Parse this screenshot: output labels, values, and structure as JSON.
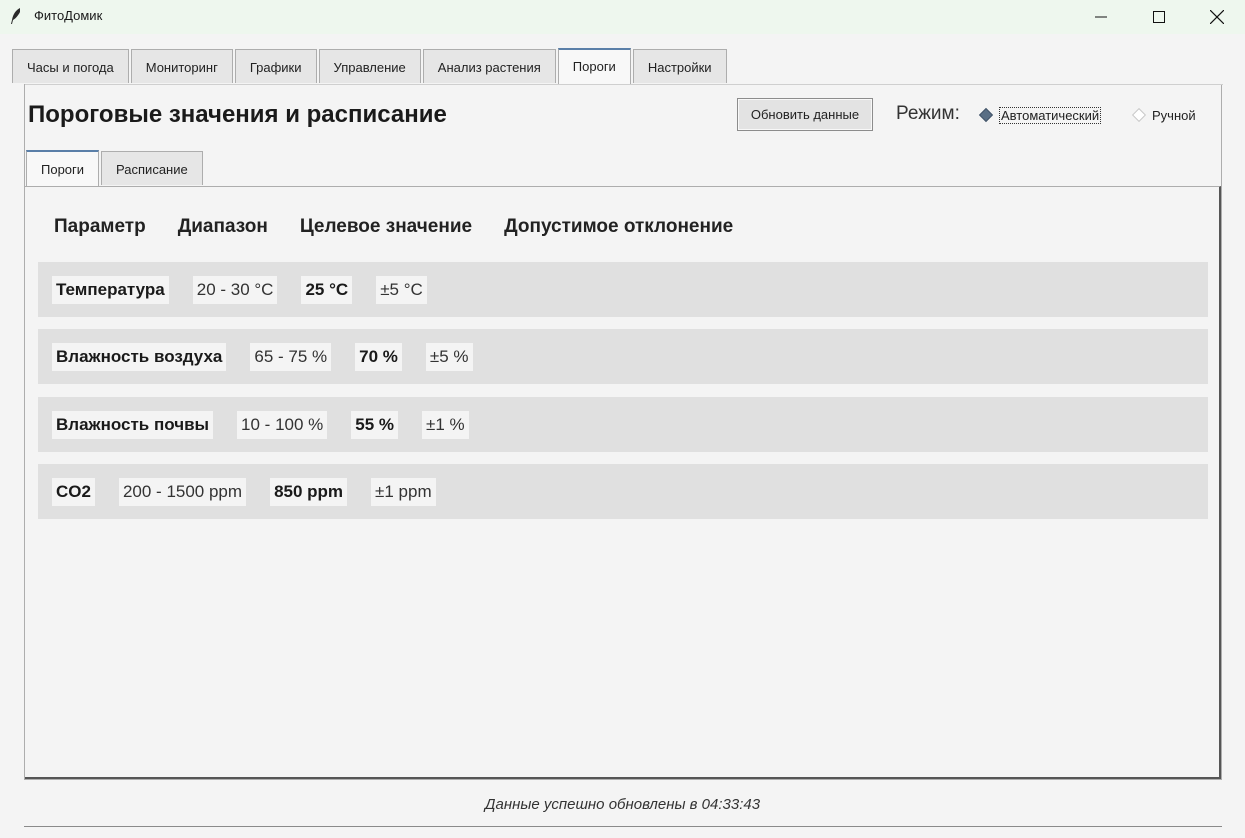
{
  "window": {
    "title": "ФитоДомик",
    "controls": {
      "minimize": "minimize-icon",
      "maximize": "maximize-icon",
      "close": "close-icon"
    },
    "icon": "feather-icon"
  },
  "main_tabs": [
    {
      "label": "Часы и погода",
      "active": false
    },
    {
      "label": "Мониторинг",
      "active": false
    },
    {
      "label": "Графики",
      "active": false
    },
    {
      "label": "Управление",
      "active": false
    },
    {
      "label": "Анализ растения",
      "active": false
    },
    {
      "label": "Пороги",
      "active": true
    },
    {
      "label": "Настройки",
      "active": false
    }
  ],
  "page": {
    "title": "Пороговые значения и расписание",
    "refresh_label": "Обновить данные",
    "mode_label": "Режим:",
    "modes": [
      {
        "label": "Автоматический",
        "selected": true
      },
      {
        "label": "Ручной",
        "selected": false
      }
    ]
  },
  "sub_tabs": [
    {
      "label": "Пороги",
      "active": true
    },
    {
      "label": "Расписание",
      "active": false
    }
  ],
  "table": {
    "headers": [
      "Параметр",
      "Диапазон",
      "Целевое значение",
      "Допустимое отклонение"
    ],
    "rows": [
      {
        "param": "Температура",
        "range": "20 - 30 °C",
        "target": "25 °C",
        "deviation": "±5 °C"
      },
      {
        "param": "Влажность воздуха",
        "range": "65 - 75 %",
        "target": "70 %",
        "deviation": "±5 %"
      },
      {
        "param": "Влажность почвы",
        "range": "10 - 100 %",
        "target": "55 %",
        "deviation": "±1 %"
      },
      {
        "param": "CO2",
        "range": "200 - 1500 ppm",
        "target": "850 ppm",
        "deviation": "±1 ppm"
      }
    ]
  },
  "status": "Данные успешно обновлены в 04:33:43",
  "colors": {
    "titlebar": "#eef7ee",
    "active_tab_accent": "#5a7fa8",
    "row_background": "#e0e0e0",
    "radio_selected": "#5a6f85"
  }
}
